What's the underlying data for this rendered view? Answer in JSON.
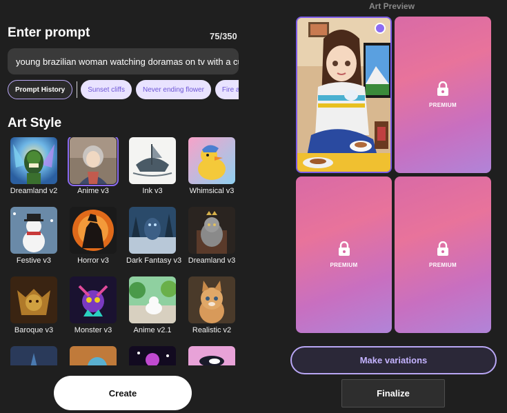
{
  "prompt": {
    "title": "Enter prompt",
    "char_count": "75/350",
    "value": "young brazilian woman watching doramas on tv with a cup"
  },
  "chips": {
    "history_label": "Prompt History",
    "suggestions": [
      "Sunset cliffs",
      "Never ending flower",
      "Fire and w"
    ]
  },
  "art_style": {
    "title": "Art Style",
    "styles": [
      {
        "label": "Dreamland v2",
        "selected": false
      },
      {
        "label": "Anime v3",
        "selected": true
      },
      {
        "label": "Ink v3",
        "selected": false
      },
      {
        "label": "Whimsical v3",
        "selected": false
      },
      {
        "label": "Festive v3",
        "selected": false
      },
      {
        "label": "Horror v3",
        "selected": false
      },
      {
        "label": "Dark Fantasy v3",
        "selected": false
      },
      {
        "label": "Dreamland v3",
        "selected": false
      },
      {
        "label": "Baroque v3",
        "selected": false
      },
      {
        "label": "Monster v3",
        "selected": false
      },
      {
        "label": "Anime v2.1",
        "selected": false
      },
      {
        "label": "Realistic v2",
        "selected": false
      },
      {
        "label": "",
        "selected": false
      },
      {
        "label": "",
        "selected": false
      },
      {
        "label": "",
        "selected": false
      },
      {
        "label": "",
        "selected": false
      }
    ]
  },
  "create_label": "Create",
  "preview": {
    "title": "Art Preview",
    "premium_label": "PREMIUM"
  },
  "make_variations_label": "Make variations",
  "finalize_label": "Finalize",
  "colors": {
    "background": "#1f1f1f",
    "accent": "#8c6cf2",
    "chip_bg": "#e9e3ff",
    "premium_gradient_start": "#d96aa6",
    "premium_gradient_end": "#b184d8"
  }
}
